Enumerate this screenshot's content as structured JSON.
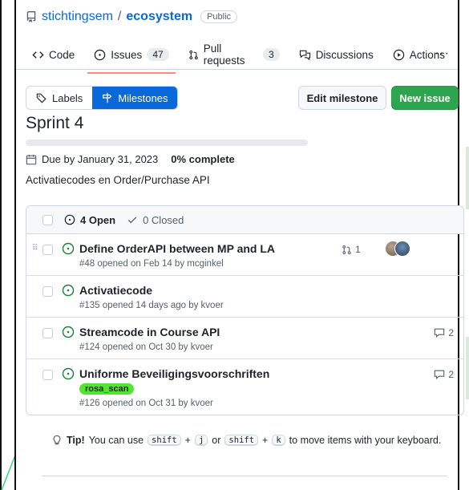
{
  "repo": {
    "owner": "stichtingsem",
    "separator": "/",
    "name": "ecosystem",
    "visibility": "Public"
  },
  "tabs": [
    {
      "label": "Code",
      "icon": "code-icon"
    },
    {
      "label": "Issues",
      "count": "47",
      "icon": "issue-opened-icon",
      "selected": true
    },
    {
      "label": "Pull requests",
      "count": "3",
      "icon": "git-pull-request-icon"
    },
    {
      "label": "Discussions",
      "icon": "comment-discussion-icon"
    },
    {
      "label": "Actions",
      "icon": "play-icon"
    }
  ],
  "more_label": "···",
  "toggle": {
    "labels": "Labels",
    "milestones": "Milestones"
  },
  "buttons": {
    "edit_milestone": "Edit milestone",
    "new_issue": "New issue"
  },
  "milestone": {
    "title": "Sprint 4",
    "progress_fraction": 0,
    "due": "Due by January 31, 2023",
    "complete": "0% complete",
    "description": "Activatiecodes en Order/Purchase API"
  },
  "issues_header": {
    "open": "4 Open",
    "closed": "0 Closed"
  },
  "issues": [
    {
      "title": "Define OrderAPI between MP and LA",
      "meta": "#48 opened on Feb 14 by mcginkel",
      "linked_prs": "1",
      "has_avatars": true
    },
    {
      "title": "Activatiecode",
      "meta": "#135 opened 14 days ago by kvoer"
    },
    {
      "title": "Streamcode in Course API",
      "meta": "#124 opened on Oct 30 by kvoer",
      "comments": "2"
    },
    {
      "title": "Uniforme Beveiligingsvoorschriften",
      "label": "rosa_scan",
      "meta": "#126 opened on Oct 31 by kvoer",
      "comments": "2"
    }
  ],
  "tip": {
    "prefix": "Tip!",
    "text1": "You can use",
    "k1": "shift",
    "plus": "+",
    "k2": "j",
    "or": "or",
    "k3": "shift",
    "k4": "k",
    "text2": "to move items with your keyboard."
  },
  "colors": {
    "accent": "#0969da",
    "open_green": "#1a7f37",
    "label_green": "#52e52f",
    "tab_underline": "#fd8c73"
  }
}
